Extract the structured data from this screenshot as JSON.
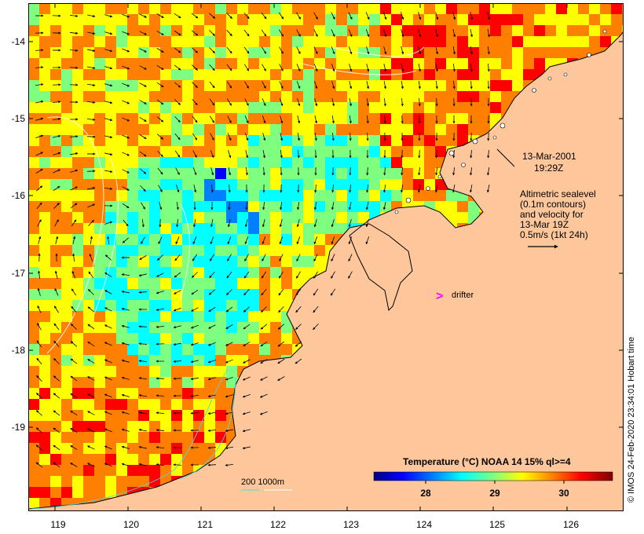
{
  "map": {
    "x_ticks": [
      "119",
      "120",
      "121",
      "122",
      "123",
      "124",
      "125",
      "126"
    ],
    "y_ticks": [
      "-14",
      "-15",
      "-16",
      "-17",
      "-18",
      "-19"
    ],
    "lon_range": [
      118.6,
      126.7
    ],
    "lat_range": [
      -19.3,
      -13.6
    ],
    "land_color": "#fec79b",
    "coast_color": "#000000",
    "contour_color": "#ffffff",
    "arrow_color": "#000000",
    "drifter_color": "#ff00ff"
  },
  "annotation": {
    "date": "13-Mar-2001",
    "time": "19:29Z",
    "altimetry_lines": [
      "Altimetric sealevel",
      "(0.1m contours)",
      "and velocity for",
      "13-Mar 19Z",
      "0.5m/s (1kt 24h)"
    ],
    "drifter_label": "drifter",
    "drifter_marker": ">"
  },
  "legend": {
    "title": "Temperature (°C) NOAA 14 15% ql>=4",
    "ticks": [
      "28",
      "29",
      "30"
    ],
    "colors": [
      "#00007f",
      "#0000ff",
      "#007fff",
      "#00ffff",
      "#7fff7f",
      "#ffff00",
      "#ff7f00",
      "#ff0000",
      "#7f0000"
    ]
  },
  "scale": {
    "label": "200  1000m"
  },
  "credit": "© IMOS 24-Feb-2020 23:34:01 Hobart time"
}
